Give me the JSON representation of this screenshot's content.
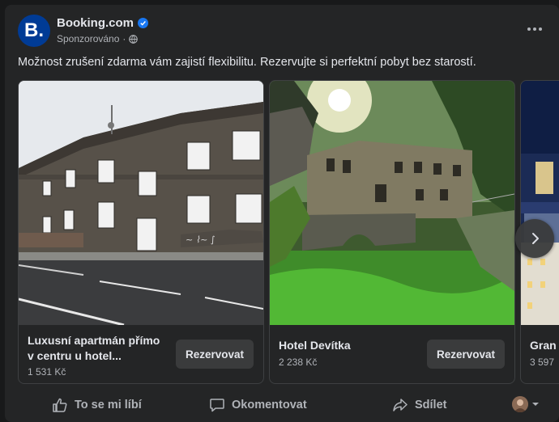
{
  "post": {
    "brand": "Booking.com",
    "logo_letter": "B.",
    "sponsored": "Sponzorováno",
    "separator": "·",
    "message": "Možnost zrušení zdarma vám zajistí flexibilitu. Rezervujte si perfektní pobyt bez starostí."
  },
  "cards": [
    {
      "title": "Luxusní apartmán přímo v centru u hotel...",
      "price": "1 531 Kč",
      "button": "Rezervovat"
    },
    {
      "title": "Hotel Devítka",
      "price": "2 238 Kč",
      "button": "Rezervovat"
    },
    {
      "title": "Gran",
      "price": "3 597"
    }
  ],
  "actions": {
    "like": "To se mi líbí",
    "comment": "Okomentovat",
    "share": "Sdílet"
  },
  "colors": {
    "background": "#18191a",
    "card": "#242526",
    "button": "#3a3b3c",
    "brand_blue": "#003b95",
    "verified": "#1877f2",
    "text_primary": "#e4e6eb",
    "text_secondary": "#b0b3b8"
  }
}
